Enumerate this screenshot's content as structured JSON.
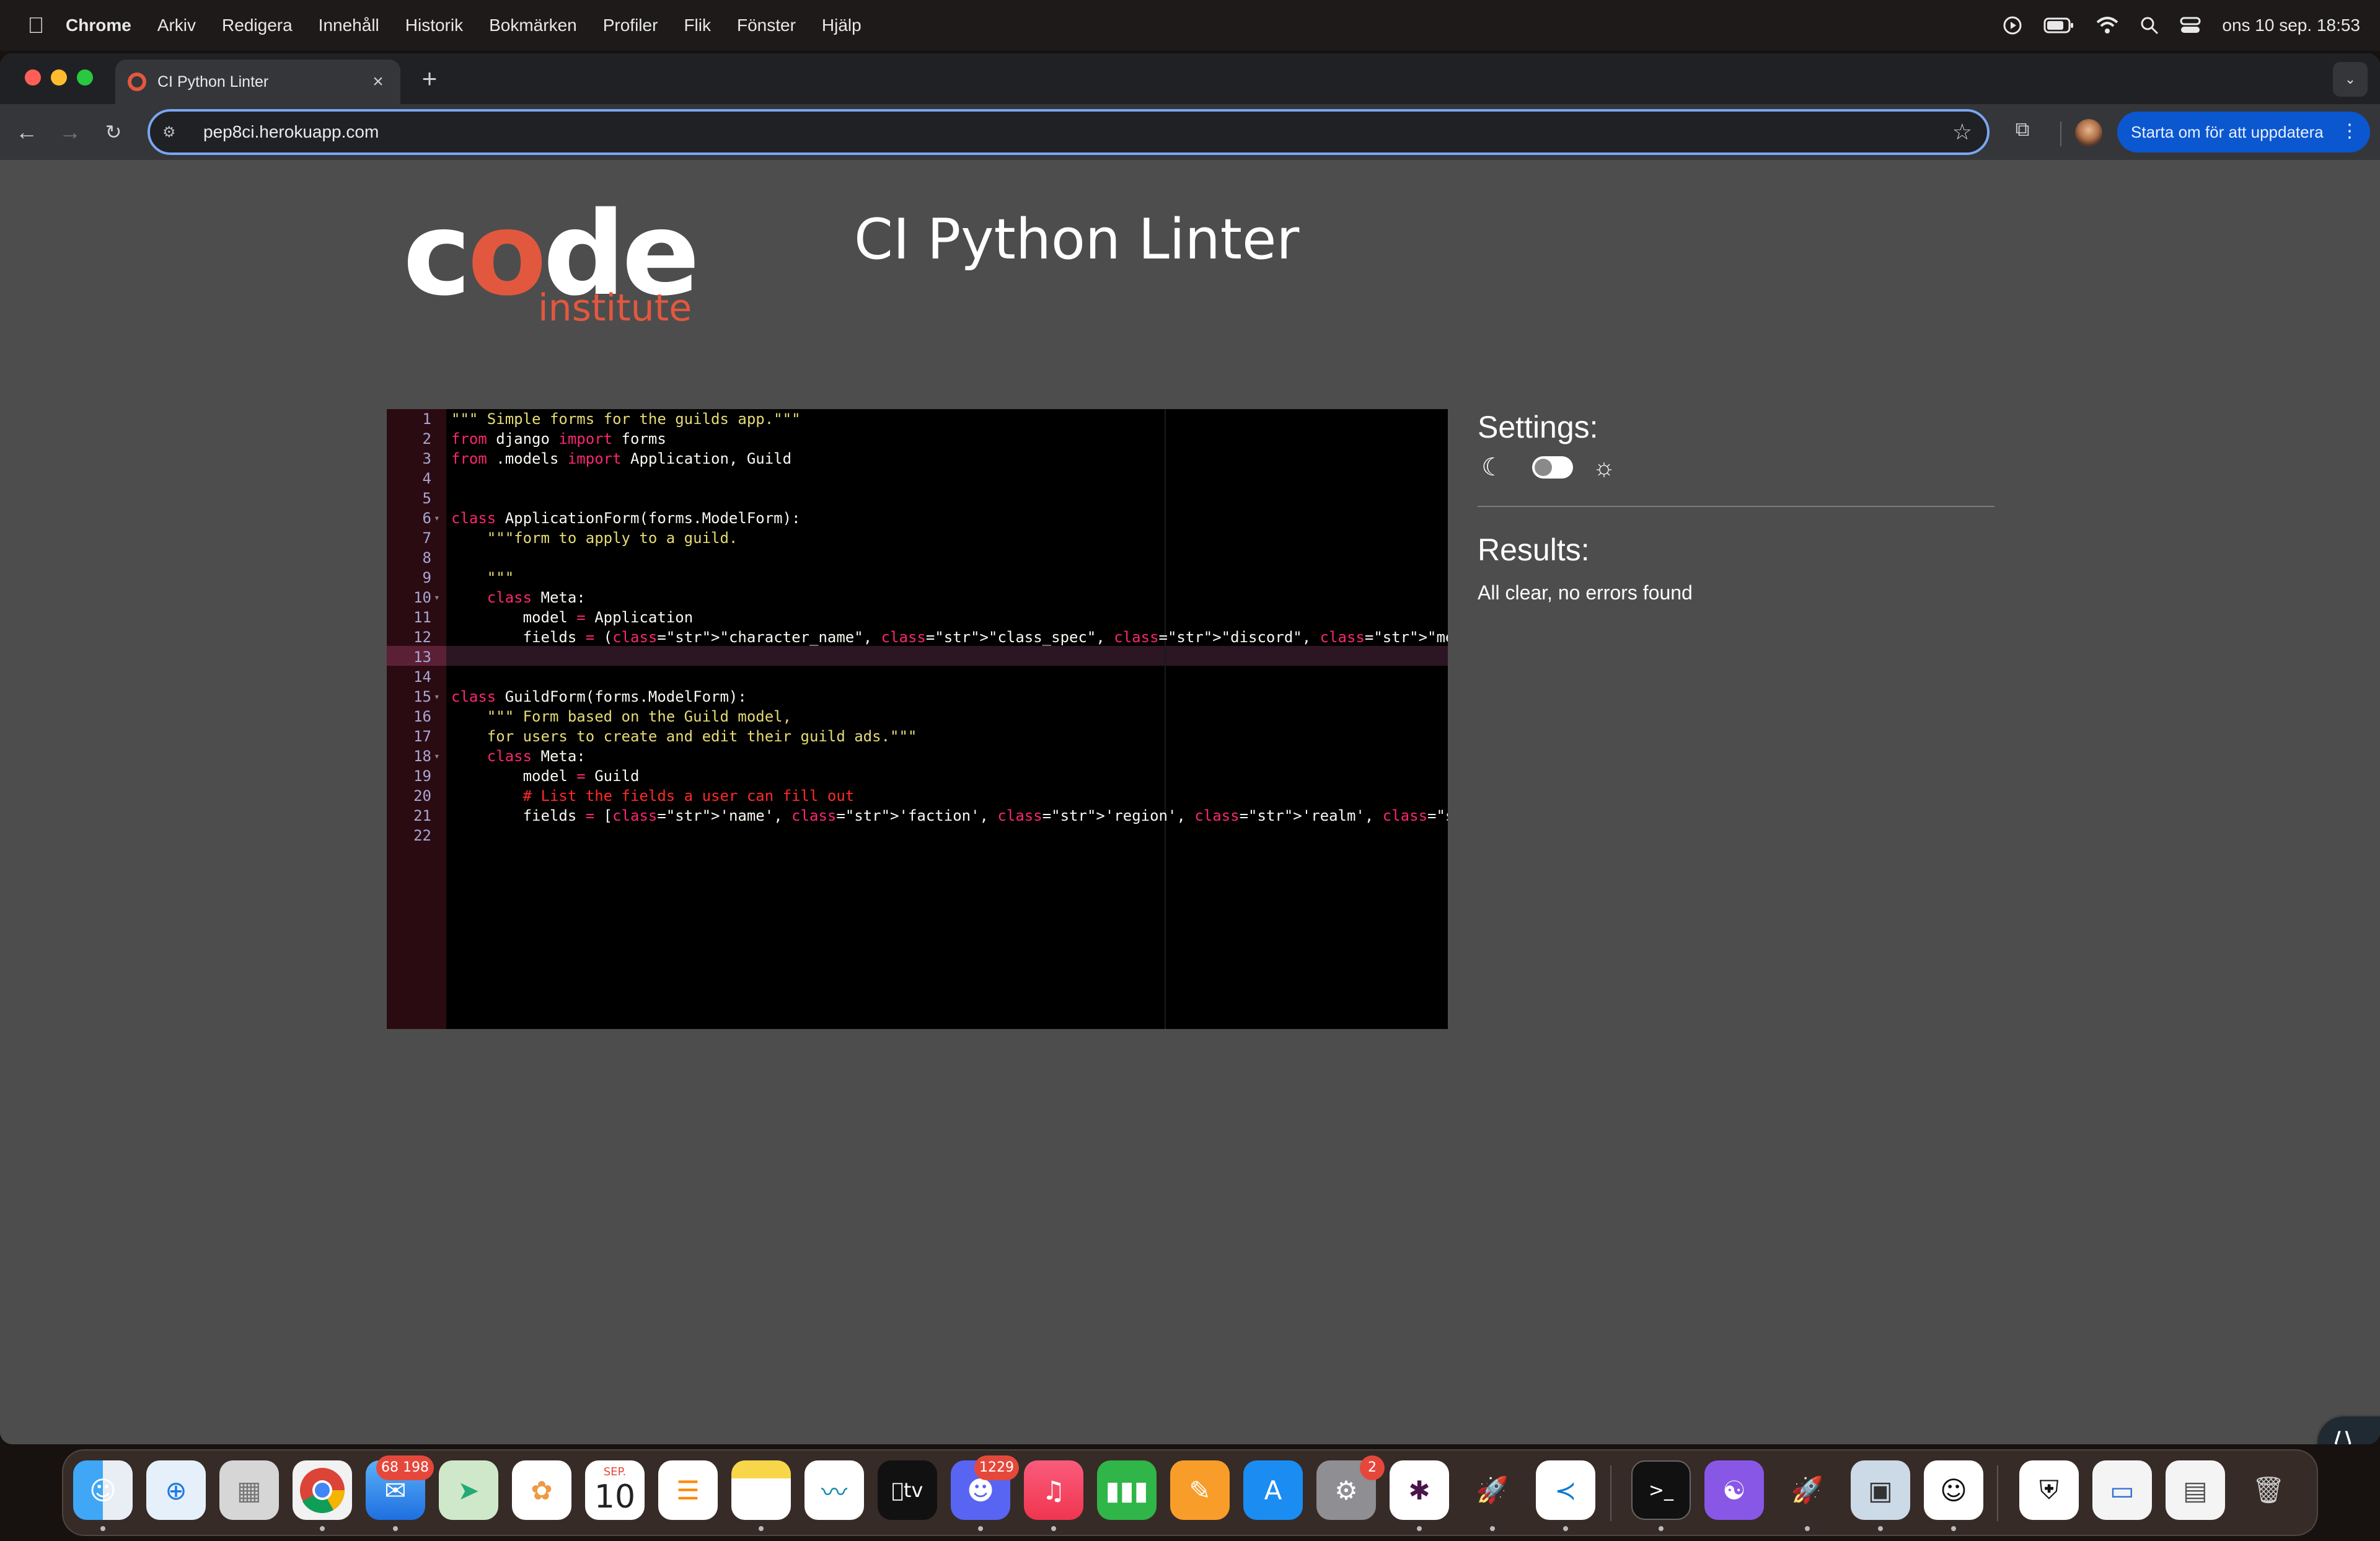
{
  "menubar": {
    "app_name": "Chrome",
    "items": [
      "Arkiv",
      "Redigera",
      "Innehåll",
      "Historik",
      "Bokmärken",
      "Profiler",
      "Flik",
      "Fönster",
      "Hjälp"
    ],
    "datetime": "ons 10 sep. 18:53"
  },
  "browser": {
    "tab_title": "CI Python Linter",
    "url": "pep8ci.herokuapp.com",
    "update_button": "Starta om för att uppdatera"
  },
  "page": {
    "logo_code": "code",
    "logo_institute": "institute",
    "title": "CI Python Linter",
    "settings_title": "Settings:",
    "results_title": "Results:",
    "results_message": "All clear, no errors found"
  },
  "editor": {
    "active_line": 13,
    "lines": [
      "\"\"\" Simple forms for the guilds app.\"\"\"",
      "from django import forms",
      "from .models import Application, Guild",
      "",
      "",
      "class ApplicationForm(forms.ModelForm):",
      "    \"\"\"form to apply to a guild.",
      "",
      "    \"\"\"",
      "    class Meta:",
      "        model = Application",
      "        fields = (\"character_name\", \"class_spec\", \"discord\", \"message\")",
      "",
      "",
      "class GuildForm(forms.ModelForm):",
      "    \"\"\" Form based on the Guild model,",
      "    for users to create and edit their guild ads.\"\"\"",
      "    class Meta:",
      "        model = Guild",
      "        # List the fields a user can fill out",
      "        fields = ['name', 'faction', 'region', 'realm', 'description', 'image']",
      ""
    ]
  },
  "dock": {
    "mail_badge": "68 198",
    "calendar_month": "SEP.",
    "calendar_day": "10",
    "tv_label": "tv",
    "discord_badge": "1229",
    "settings_badge": "2"
  },
  "colors": {
    "accent": "#e2583e",
    "page_bg": "#4d4d4d",
    "editor_bg": "#000000",
    "keyword": "#f92672",
    "string": "#e6db74",
    "update_button": "#0b57d0"
  }
}
